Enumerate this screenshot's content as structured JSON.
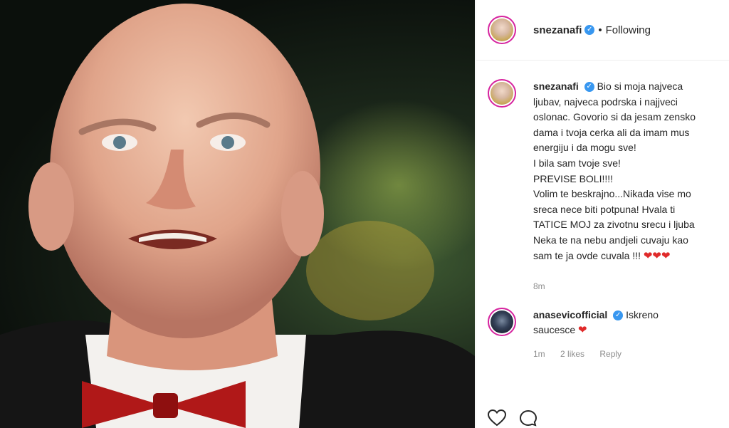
{
  "post": {
    "image_alt": "portrait photo"
  },
  "header": {
    "username": "snezanafi",
    "verified_mark": "✓",
    "separator": "•",
    "follow_status": "Following"
  },
  "caption": {
    "username": "snezanafi",
    "lines": [
      "Bio si moja najveca",
      "ljubav, najveca podrska i najjveci",
      "oslonac. Govorio si da jesam zensko",
      "dama i tvoja cerka ali da imam mus",
      "energiju i da mogu sve!",
      "I bila sam tvoje sve!",
      "PREVISE BOLI!!!!",
      "Volim te beskrajno...Nikada vise mo",
      "sreca nece biti potpuna! Hvala ti",
      "TATICE MOJ za zivotnu srecu i ljuba",
      "Neka te na nebu andjeli cuvaju kao",
      "sam te ja ovde cuvala !!!"
    ],
    "hearts": "❤❤❤",
    "time": "8m"
  },
  "comment": {
    "username": "anasevicofficial",
    "text_line1": "Iskreno",
    "text_line2": "saucesce",
    "heart": "❤",
    "time": "1m",
    "likes": "2 likes",
    "reply": "Reply"
  },
  "icons": {
    "like": "heart-outline-icon",
    "comment": "comment-bubble-icon"
  }
}
